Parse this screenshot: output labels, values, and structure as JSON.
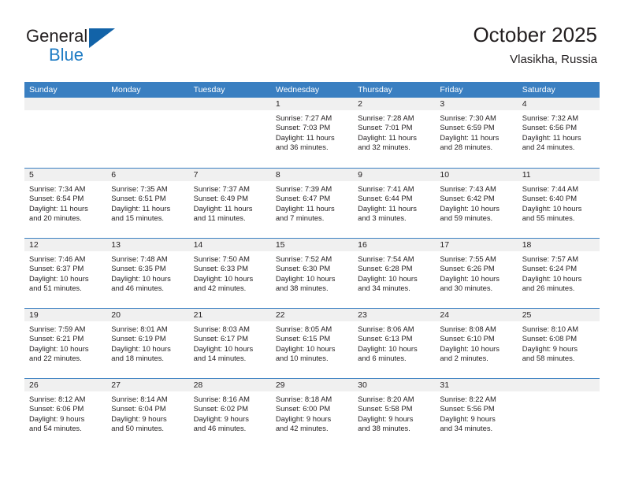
{
  "brand": {
    "name_top": "General",
    "name_bottom": "Blue",
    "logo_icon": "triangle-logo-icon"
  },
  "header": {
    "title": "October 2025",
    "location": "Vlasikha, Russia"
  },
  "colors": {
    "header_blue": "#3a7fc1",
    "brand_blue": "#1f7cc4",
    "logo_blue": "#1263a8",
    "day_bar_gray": "#f0f0f0",
    "text": "#231f20"
  },
  "weekdays": [
    "Sunday",
    "Monday",
    "Tuesday",
    "Wednesday",
    "Thursday",
    "Friday",
    "Saturday"
  ],
  "weeks": [
    [
      {
        "day": "",
        "empty": true,
        "lines": []
      },
      {
        "day": "",
        "empty": true,
        "lines": []
      },
      {
        "day": "",
        "empty": true,
        "lines": []
      },
      {
        "day": "1",
        "empty": false,
        "lines": [
          "Sunrise: 7:27 AM",
          "Sunset: 7:03 PM",
          "Daylight: 11 hours",
          "and 36 minutes."
        ]
      },
      {
        "day": "2",
        "empty": false,
        "lines": [
          "Sunrise: 7:28 AM",
          "Sunset: 7:01 PM",
          "Daylight: 11 hours",
          "and 32 minutes."
        ]
      },
      {
        "day": "3",
        "empty": false,
        "lines": [
          "Sunrise: 7:30 AM",
          "Sunset: 6:59 PM",
          "Daylight: 11 hours",
          "and 28 minutes."
        ]
      },
      {
        "day": "4",
        "empty": false,
        "lines": [
          "Sunrise: 7:32 AM",
          "Sunset: 6:56 PM",
          "Daylight: 11 hours",
          "and 24 minutes."
        ]
      }
    ],
    [
      {
        "day": "5",
        "empty": false,
        "lines": [
          "Sunrise: 7:34 AM",
          "Sunset: 6:54 PM",
          "Daylight: 11 hours",
          "and 20 minutes."
        ]
      },
      {
        "day": "6",
        "empty": false,
        "lines": [
          "Sunrise: 7:35 AM",
          "Sunset: 6:51 PM",
          "Daylight: 11 hours",
          "and 15 minutes."
        ]
      },
      {
        "day": "7",
        "empty": false,
        "lines": [
          "Sunrise: 7:37 AM",
          "Sunset: 6:49 PM",
          "Daylight: 11 hours",
          "and 11 minutes."
        ]
      },
      {
        "day": "8",
        "empty": false,
        "lines": [
          "Sunrise: 7:39 AM",
          "Sunset: 6:47 PM",
          "Daylight: 11 hours",
          "and 7 minutes."
        ]
      },
      {
        "day": "9",
        "empty": false,
        "lines": [
          "Sunrise: 7:41 AM",
          "Sunset: 6:44 PM",
          "Daylight: 11 hours",
          "and 3 minutes."
        ]
      },
      {
        "day": "10",
        "empty": false,
        "lines": [
          "Sunrise: 7:43 AM",
          "Sunset: 6:42 PM",
          "Daylight: 10 hours",
          "and 59 minutes."
        ]
      },
      {
        "day": "11",
        "empty": false,
        "lines": [
          "Sunrise: 7:44 AM",
          "Sunset: 6:40 PM",
          "Daylight: 10 hours",
          "and 55 minutes."
        ]
      }
    ],
    [
      {
        "day": "12",
        "empty": false,
        "lines": [
          "Sunrise: 7:46 AM",
          "Sunset: 6:37 PM",
          "Daylight: 10 hours",
          "and 51 minutes."
        ]
      },
      {
        "day": "13",
        "empty": false,
        "lines": [
          "Sunrise: 7:48 AM",
          "Sunset: 6:35 PM",
          "Daylight: 10 hours",
          "and 46 minutes."
        ]
      },
      {
        "day": "14",
        "empty": false,
        "lines": [
          "Sunrise: 7:50 AM",
          "Sunset: 6:33 PM",
          "Daylight: 10 hours",
          "and 42 minutes."
        ]
      },
      {
        "day": "15",
        "empty": false,
        "lines": [
          "Sunrise: 7:52 AM",
          "Sunset: 6:30 PM",
          "Daylight: 10 hours",
          "and 38 minutes."
        ]
      },
      {
        "day": "16",
        "empty": false,
        "lines": [
          "Sunrise: 7:54 AM",
          "Sunset: 6:28 PM",
          "Daylight: 10 hours",
          "and 34 minutes."
        ]
      },
      {
        "day": "17",
        "empty": false,
        "lines": [
          "Sunrise: 7:55 AM",
          "Sunset: 6:26 PM",
          "Daylight: 10 hours",
          "and 30 minutes."
        ]
      },
      {
        "day": "18",
        "empty": false,
        "lines": [
          "Sunrise: 7:57 AM",
          "Sunset: 6:24 PM",
          "Daylight: 10 hours",
          "and 26 minutes."
        ]
      }
    ],
    [
      {
        "day": "19",
        "empty": false,
        "lines": [
          "Sunrise: 7:59 AM",
          "Sunset: 6:21 PM",
          "Daylight: 10 hours",
          "and 22 minutes."
        ]
      },
      {
        "day": "20",
        "empty": false,
        "lines": [
          "Sunrise: 8:01 AM",
          "Sunset: 6:19 PM",
          "Daylight: 10 hours",
          "and 18 minutes."
        ]
      },
      {
        "day": "21",
        "empty": false,
        "lines": [
          "Sunrise: 8:03 AM",
          "Sunset: 6:17 PM",
          "Daylight: 10 hours",
          "and 14 minutes."
        ]
      },
      {
        "day": "22",
        "empty": false,
        "lines": [
          "Sunrise: 8:05 AM",
          "Sunset: 6:15 PM",
          "Daylight: 10 hours",
          "and 10 minutes."
        ]
      },
      {
        "day": "23",
        "empty": false,
        "lines": [
          "Sunrise: 8:06 AM",
          "Sunset: 6:13 PM",
          "Daylight: 10 hours",
          "and 6 minutes."
        ]
      },
      {
        "day": "24",
        "empty": false,
        "lines": [
          "Sunrise: 8:08 AM",
          "Sunset: 6:10 PM",
          "Daylight: 10 hours",
          "and 2 minutes."
        ]
      },
      {
        "day": "25",
        "empty": false,
        "lines": [
          "Sunrise: 8:10 AM",
          "Sunset: 6:08 PM",
          "Daylight: 9 hours",
          "and 58 minutes."
        ]
      }
    ],
    [
      {
        "day": "26",
        "empty": false,
        "lines": [
          "Sunrise: 8:12 AM",
          "Sunset: 6:06 PM",
          "Daylight: 9 hours",
          "and 54 minutes."
        ]
      },
      {
        "day": "27",
        "empty": false,
        "lines": [
          "Sunrise: 8:14 AM",
          "Sunset: 6:04 PM",
          "Daylight: 9 hours",
          "and 50 minutes."
        ]
      },
      {
        "day": "28",
        "empty": false,
        "lines": [
          "Sunrise: 8:16 AM",
          "Sunset: 6:02 PM",
          "Daylight: 9 hours",
          "and 46 minutes."
        ]
      },
      {
        "day": "29",
        "empty": false,
        "lines": [
          "Sunrise: 8:18 AM",
          "Sunset: 6:00 PM",
          "Daylight: 9 hours",
          "and 42 minutes."
        ]
      },
      {
        "day": "30",
        "empty": false,
        "lines": [
          "Sunrise: 8:20 AM",
          "Sunset: 5:58 PM",
          "Daylight: 9 hours",
          "and 38 minutes."
        ]
      },
      {
        "day": "31",
        "empty": false,
        "lines": [
          "Sunrise: 8:22 AM",
          "Sunset: 5:56 PM",
          "Daylight: 9 hours",
          "and 34 minutes."
        ]
      },
      {
        "day": "",
        "empty": true,
        "lines": []
      }
    ]
  ]
}
